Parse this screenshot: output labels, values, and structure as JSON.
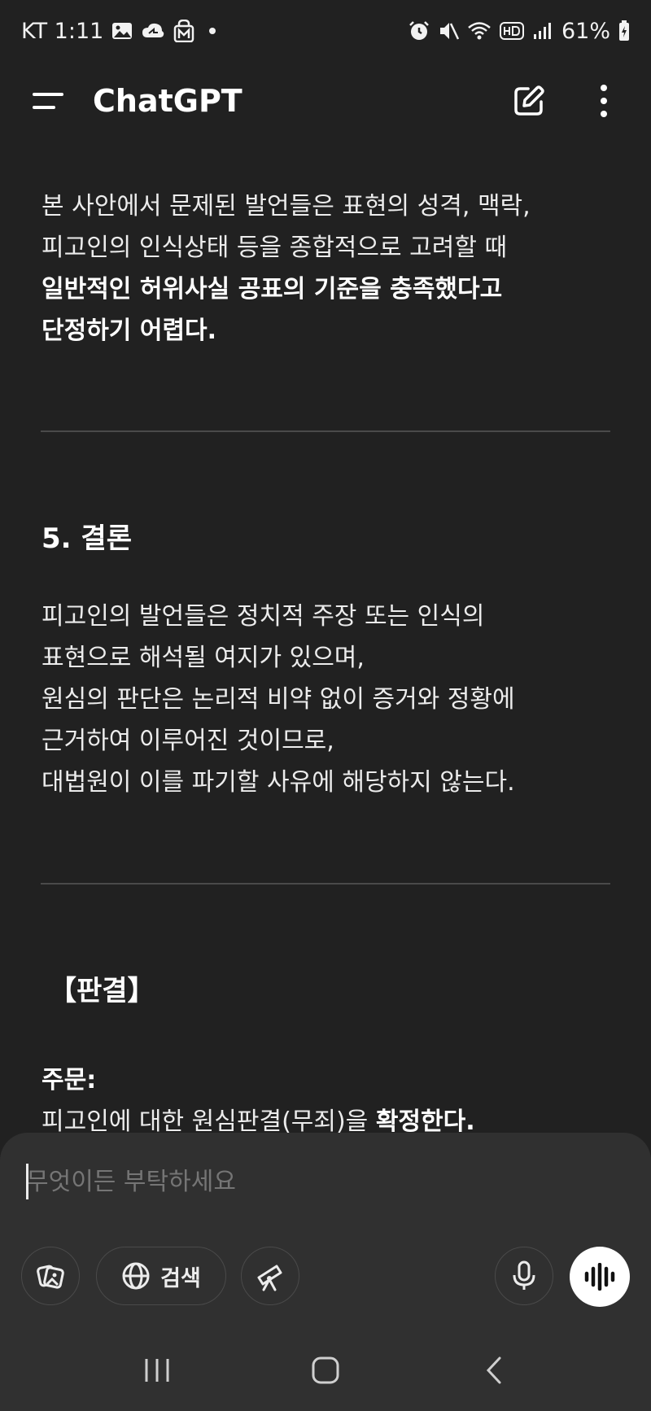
{
  "status_bar": {
    "carrier_time": "KT 1:11",
    "battery": "61%"
  },
  "header": {
    "title": "ChatGPT"
  },
  "content": {
    "para1": [
      "본 사안에서 문제된 발언들은 표현의 성격, 맥락,",
      "피고인의 인식상태 등을 종합적으로 고려할 때"
    ],
    "para1_bold": [
      "일반적인 허위사실 공표의 기준을 충족했다고",
      "단정하기 어렵다."
    ],
    "section_heading": "5. 결론",
    "para2": [
      "피고인의 발언들은 정치적 주장 또는 인식의",
      "표현으로 해석될 여지가 있으며,",
      "원심의 판단은 논리적 비약 없이 증거와 정황에",
      "근거하여 이루어진 것이므로,",
      "대법원이 이를 파기할 사유에 해당하지 않는다."
    ],
    "verdict_heading": "【판결】",
    "order_label": "주문:",
    "order_text_prefix": "피고인에 대한 원심판결(무죄)을 ",
    "order_text_bold": "확정한다."
  },
  "composer": {
    "placeholder": "무엇이든 부탁하세요",
    "search_label": "검색"
  },
  "colors": {
    "background": "#212121",
    "composer_bg": "#303030",
    "text": "#ECECEC",
    "divider": "#4A4A4A"
  }
}
